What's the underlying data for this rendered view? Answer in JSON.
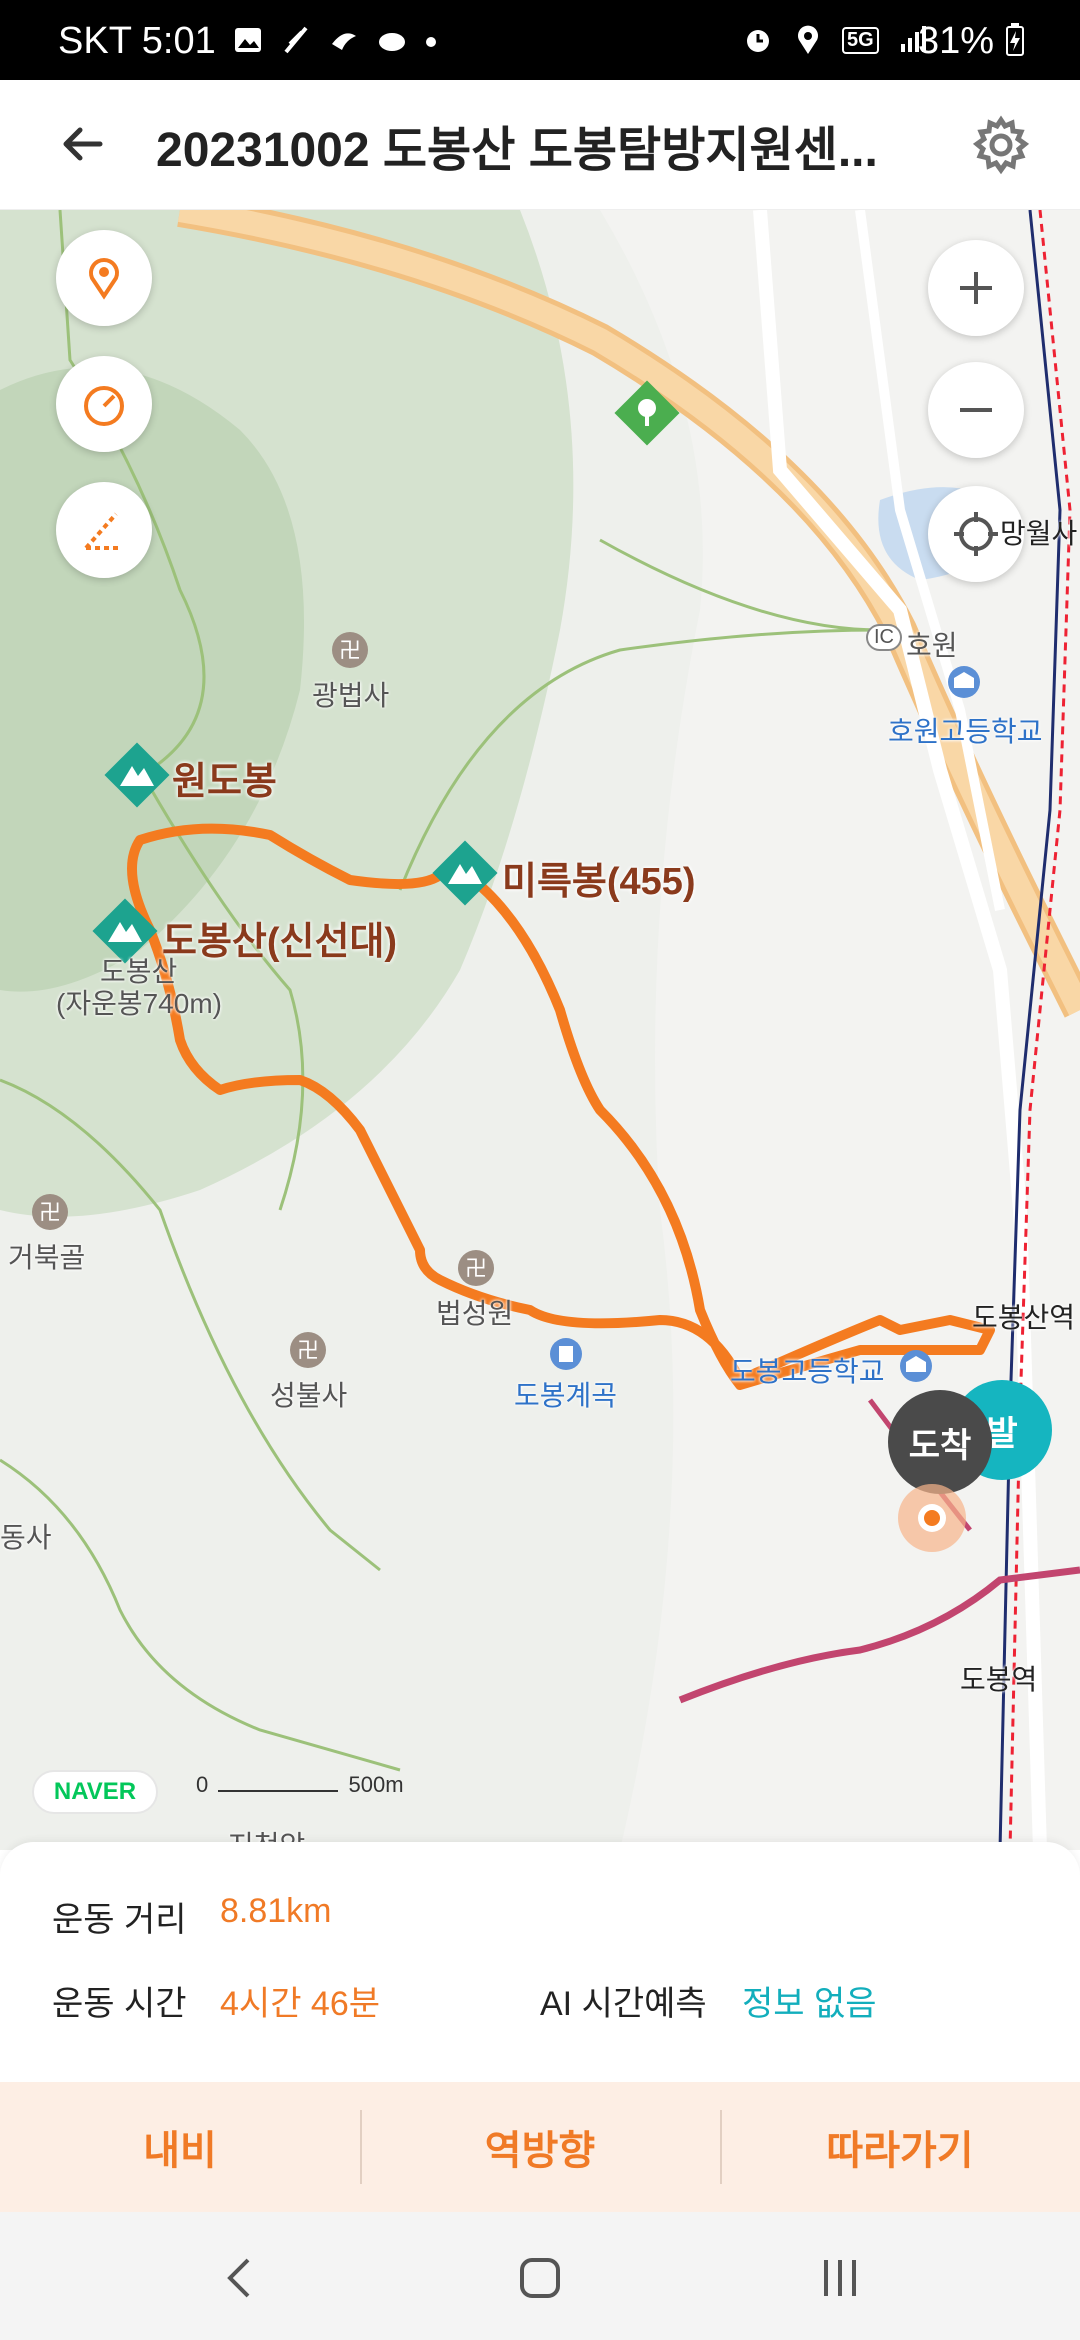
{
  "status_bar": {
    "carrier": "SKT",
    "time": "5:01",
    "network": "5G",
    "battery": "31%"
  },
  "header": {
    "title": "20231002 도봉산 도봉탐방지원센...",
    "back_icon": "arrow-left-icon",
    "settings_icon": "gear-icon"
  },
  "map": {
    "peaks": {
      "wondobong": "원도봉",
      "mireukbong": "미륵봉(455)",
      "dobongsan": "도봉산(신선대)",
      "jaunbong_line1": "도봉산",
      "jaunbong_line2": "(자운봉740m)"
    },
    "pois": {
      "gwangbeopsa": "광법사",
      "geobukgol": "거북골",
      "beopsungwon": "법성원",
      "seongbulsa": "성불사",
      "dobong_valley": "도봉계곡",
      "dobong_high": "도봉고등학교",
      "howon_high": "호원고등학교",
      "howon_ic_badge": "IC",
      "howon_ic": "호원",
      "mangwolsa": "망월사",
      "dobongsan_station": "도봉산역",
      "dobong_station": "도봉역",
      "west_temple": "동사",
      "jicheonam": "지천암"
    },
    "markers": {
      "arrive": "도착",
      "depart": "발"
    },
    "naver": "NAVER",
    "scale_start": "0",
    "scale_end": "500m",
    "route_color": "#f47b20"
  },
  "stats": {
    "distance_label": "운동 거리",
    "distance_value": "8.81km",
    "time_label": "운동 시간",
    "time_value": "4시간 46분",
    "ai_label": "AI 시간예측",
    "ai_value": "정보 없음"
  },
  "actions": {
    "navi": "내비",
    "reverse": "역방향",
    "follow": "따라가기"
  }
}
